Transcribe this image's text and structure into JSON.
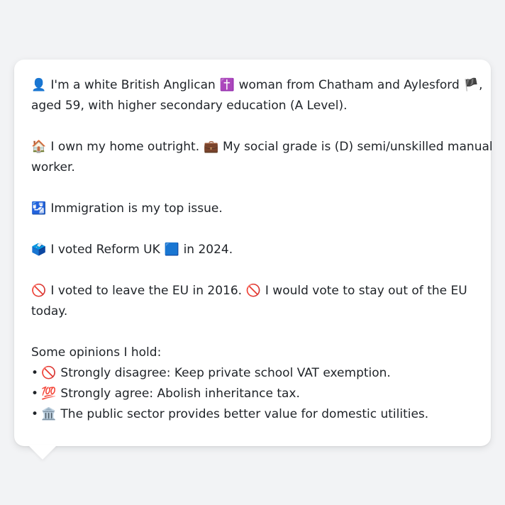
{
  "intro": {
    "icon_person": "👤",
    "part1": "I'm a white British Anglican",
    "icon_cross": "✝️",
    "part2": "woman from Chatham and Aylesford",
    "icon_flag": "🏴",
    "part3": ",",
    "line2": "aged 59, with higher secondary education (A Level)."
  },
  "home": {
    "icon_house": "🏠",
    "text1": "I own my home outright.",
    "icon_briefcase": "💼",
    "text2": "My social grade is (D) semi/unskilled manual",
    "line2": "worker."
  },
  "issue": {
    "icon": "🛂",
    "text": "Immigration is my top issue."
  },
  "vote": {
    "icon_ballot": "🗳️",
    "text1": "I voted Reform UK",
    "icon_square": "🟦",
    "text2": "in 2024."
  },
  "eu": {
    "icon1": "🚫",
    "text1": "I voted to leave the EU in 2016.",
    "icon2": "🚫",
    "text2": "I would vote to stay out of the EU",
    "line2": "today."
  },
  "opinions": {
    "heading": "Some opinions I hold:",
    "bullet": "•",
    "items": [
      {
        "icon": "🚫",
        "text": "Strongly disagree: Keep private school VAT exemption."
      },
      {
        "icon": "💯",
        "text": "Strongly agree: Abolish inheritance tax."
      },
      {
        "icon": "🏛️",
        "text": "The public sector provides better value for domestic utilities."
      }
    ]
  }
}
